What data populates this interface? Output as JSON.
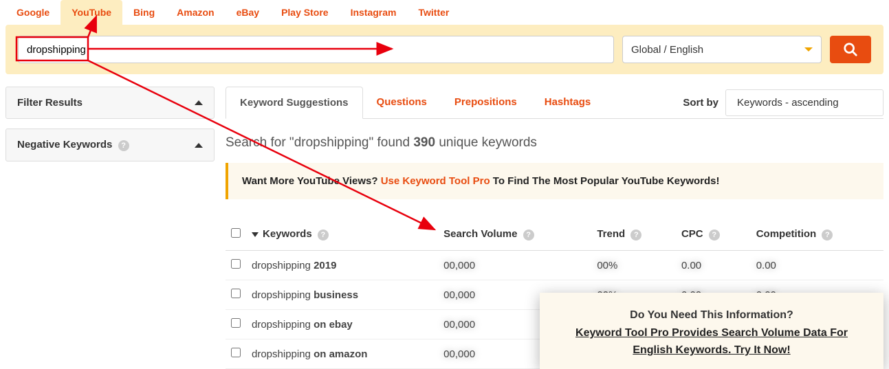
{
  "tabs": [
    "Google",
    "YouTube",
    "Bing",
    "Amazon",
    "eBay",
    "Play Store",
    "Instagram",
    "Twitter"
  ],
  "active_tab_index": 1,
  "search": {
    "value": "dropshipping",
    "locale": "Global / English"
  },
  "sidebar": {
    "filter_label": "Filter Results",
    "negative_label": "Negative Keywords"
  },
  "subtabs": [
    "Keyword Suggestions",
    "Questions",
    "Prepositions",
    "Hashtags"
  ],
  "active_subtab_index": 0,
  "sort": {
    "label": "Sort by",
    "value": "Keywords - ascending"
  },
  "results": {
    "prefix": "Search for \"",
    "term": "dropshipping",
    "mid": "\" found ",
    "count": "390",
    "suffix": " unique keywords"
  },
  "promo": {
    "lead": "Want More YouTube Views? ",
    "link": "Use Keyword Tool Pro",
    "tail": " To Find The Most Popular YouTube Keywords!"
  },
  "columns": {
    "keywords": "Keywords",
    "volume": "Search Volume",
    "trend": "Trend",
    "cpc": "CPC",
    "competition": "Competition"
  },
  "rows": [
    {
      "pre": "dropshipping ",
      "bold": "2019"
    },
    {
      "pre": "dropshipping ",
      "bold": "business"
    },
    {
      "pre": "dropshipping ",
      "bold": "on ebay"
    },
    {
      "pre": "dropshipping ",
      "bold": "on amazon"
    }
  ],
  "popup": {
    "line1": "Do You Need This Information?",
    "link": "Keyword Tool Pro Provides Search Volume Data For English Keywords",
    "cta": ". Try It Now!"
  }
}
